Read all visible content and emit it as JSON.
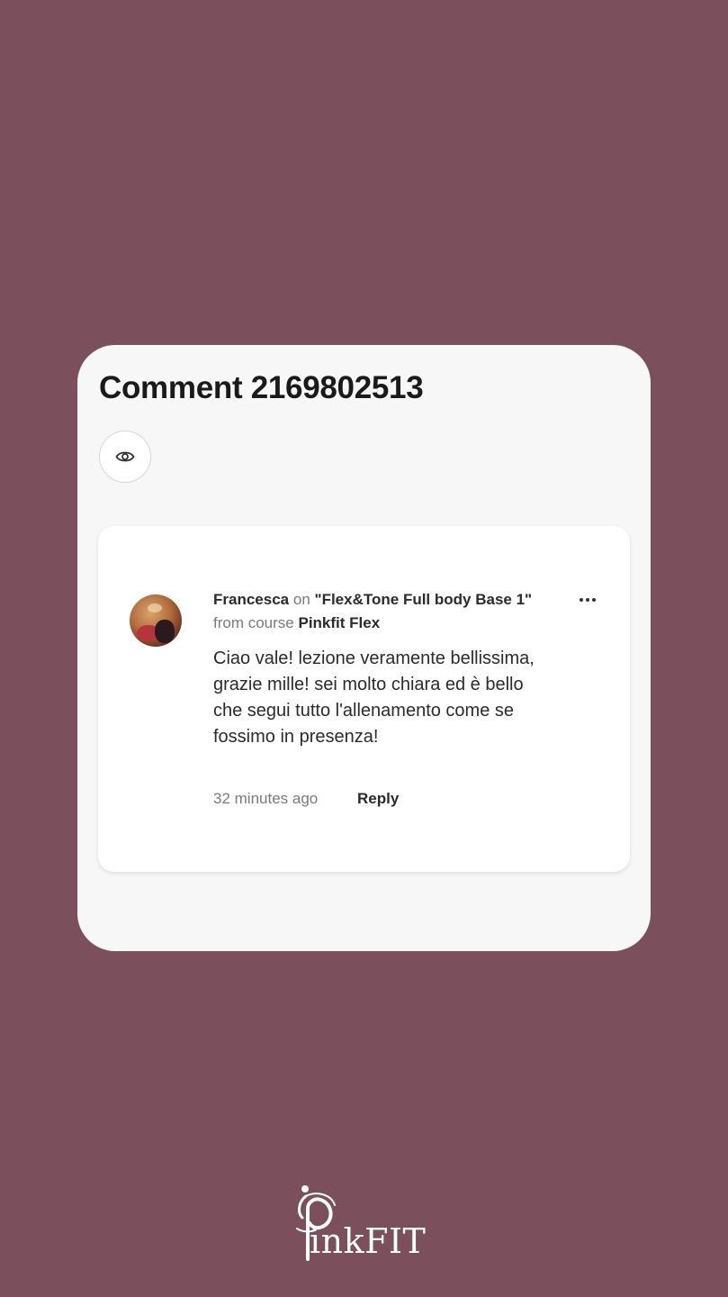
{
  "header": {
    "title": "Comment 2169802513",
    "view_icon": "eye-icon"
  },
  "comment": {
    "author": "Francesca",
    "on_word": "on",
    "lesson_title": "\"Flex&Tone Full body Base 1\"",
    "from_course_label": "from course",
    "course_name": "Pinkfit Flex",
    "text": "Ciao vale! lezione veramente bellissima, grazie mille! sei molto chiara ed è bello che segui tutto l'allenamento come se fossimo in presenza!",
    "time_ago": "32 minutes ago",
    "reply_label": "Reply",
    "more_icon": "more-options-icon",
    "avatar_icon": "avatar"
  },
  "brand": {
    "logo_text": "inkFIT",
    "logo_full": "PinkFIT"
  },
  "colors": {
    "background": "#7b4f5b",
    "panel": "#f7f7f7",
    "card": "#ffffff",
    "text_primary": "#2b2b2b",
    "text_secondary": "#7a7a7a"
  }
}
